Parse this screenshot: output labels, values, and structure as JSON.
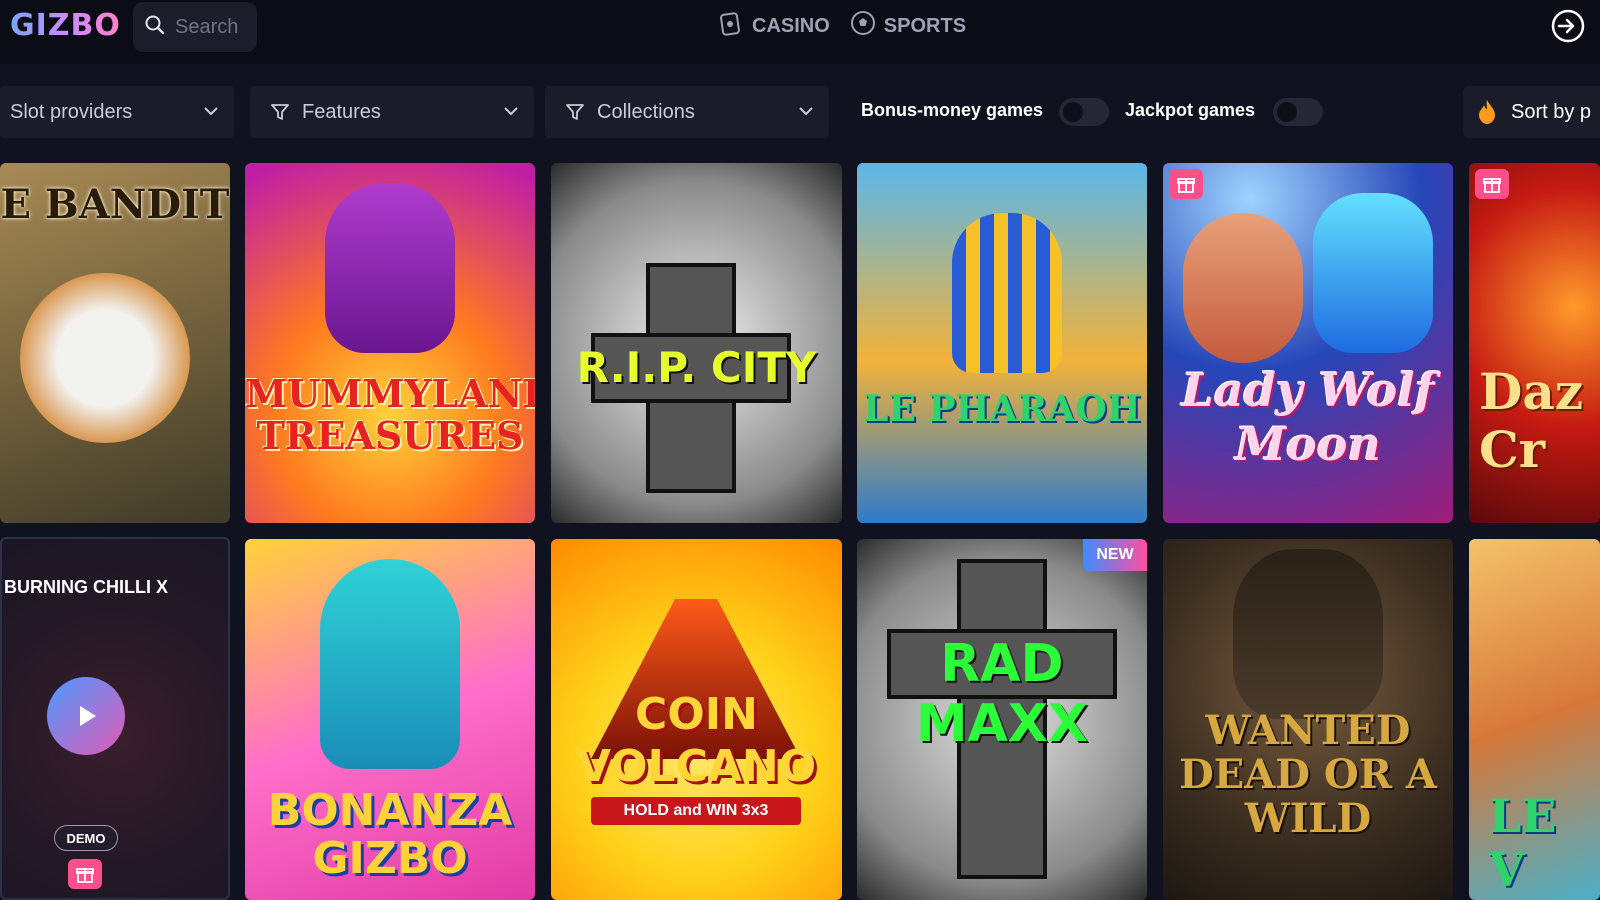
{
  "header": {
    "logo_text": "GIZBO",
    "search_placeholder": "Search",
    "nav": [
      {
        "label": "CASINO",
        "icon": "casino-icon"
      },
      {
        "label": "SPORTS",
        "icon": "soccer-ball-icon"
      }
    ],
    "login_icon": "login-icon"
  },
  "filters": {
    "slot_providers": "Slot providers",
    "features": "Features",
    "collections": "Collections",
    "bonus_money_games": "Bonus-money games",
    "jackpot_games": "Jackpot games",
    "sort_label": "Sort by p"
  },
  "games_row1": [
    {
      "title": "E BANDIT",
      "colors": [
        "#8a6b3c",
        "#3f3a27"
      ],
      "gift": false
    },
    {
      "title": "MUMMYLAND TREASURES",
      "colors": [
        "#ff9a1f",
        "#c01ea5"
      ],
      "gift": false
    },
    {
      "title": "R.I.P. CITY",
      "colors": [
        "#d9d9d9",
        "#2b2b2b"
      ],
      "gift": false
    },
    {
      "title": "LE PHARAOH",
      "colors": [
        "#f2b23a",
        "#2e7bc9"
      ],
      "gift": false
    },
    {
      "title": "Lady Wolf Moon",
      "colors": [
        "#2646b8",
        "#a01d7a"
      ],
      "gift": true
    },
    {
      "title": "Daz Cr",
      "colors": [
        "#c51a12",
        "#5a0a0a"
      ],
      "gift": true
    }
  ],
  "games_row2": [
    {
      "title": "BONANZA GIZBO",
      "colors": [
        "#ffcf3a",
        "#e13aa5"
      ],
      "new": false
    },
    {
      "title": "COIN VOLCANO",
      "subtitle": "HOLD and WIN 3x3",
      "colors": [
        "#ffd21a",
        "#ff8a00"
      ],
      "new": false
    },
    {
      "title": "RAD MAXX",
      "colors": [
        "#cfcfcf",
        "#2b2b2b"
      ],
      "new": true
    },
    {
      "title": "WANTED DEAD OR A WILD",
      "colors": [
        "#5a4632",
        "#1d1712"
      ],
      "new": false
    },
    {
      "title": "LE V",
      "colors": [
        "#f4a93c",
        "#4ab0c8"
      ],
      "new": false
    }
  ],
  "hover_game": {
    "title": "BURNING CHILLI X",
    "demo_label": "DEMO"
  },
  "new_badge": "NEW",
  "colors": {
    "background": "#11121f",
    "header": "#0b0c15",
    "control": "#1a1c2a",
    "accent_pink": "#ff4f8b",
    "accent_blue": "#4b9bff"
  }
}
